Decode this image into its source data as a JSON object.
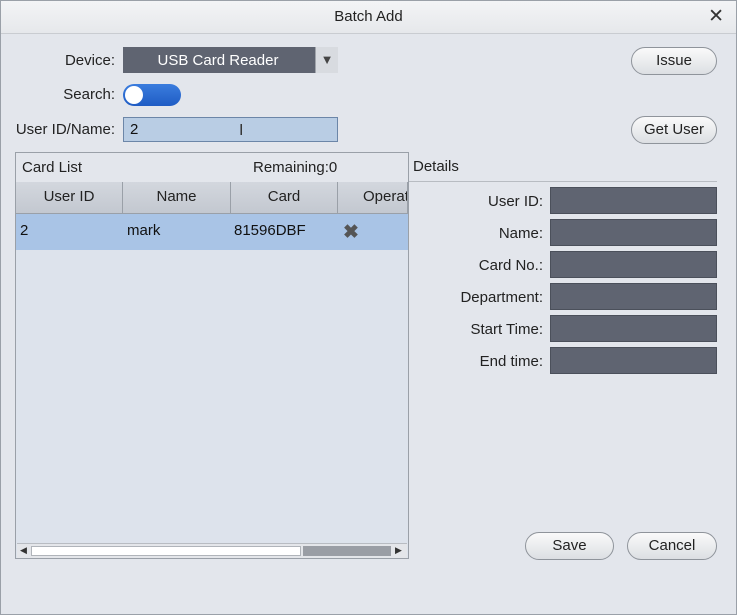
{
  "window": {
    "title": "Batch Add"
  },
  "form": {
    "device_label": "Device:",
    "device_value": "USB Card Reader",
    "search_label": "Search:",
    "search_on": true,
    "userid_label": "User ID/Name:",
    "userid_value": "2"
  },
  "buttons": {
    "issue": "Issue",
    "get_user": "Get User",
    "save": "Save",
    "cancel": "Cancel"
  },
  "card_list": {
    "title": "Card List",
    "remaining": "Remaining:0",
    "columns": [
      "User ID",
      "Name",
      "Card",
      "Operat"
    ],
    "rows": [
      {
        "user_id": "2",
        "name": "mark",
        "card": "81596DBF"
      }
    ]
  },
  "details": {
    "title": "Details",
    "fields": [
      "User ID:",
      "Name:",
      "Card No.:",
      "Department:",
      "Start Time:",
      "End time:"
    ]
  },
  "colors": {
    "accent": "#1f5cc4",
    "field_bg": "#5f6471",
    "selected_row": "#a9c4e6"
  }
}
